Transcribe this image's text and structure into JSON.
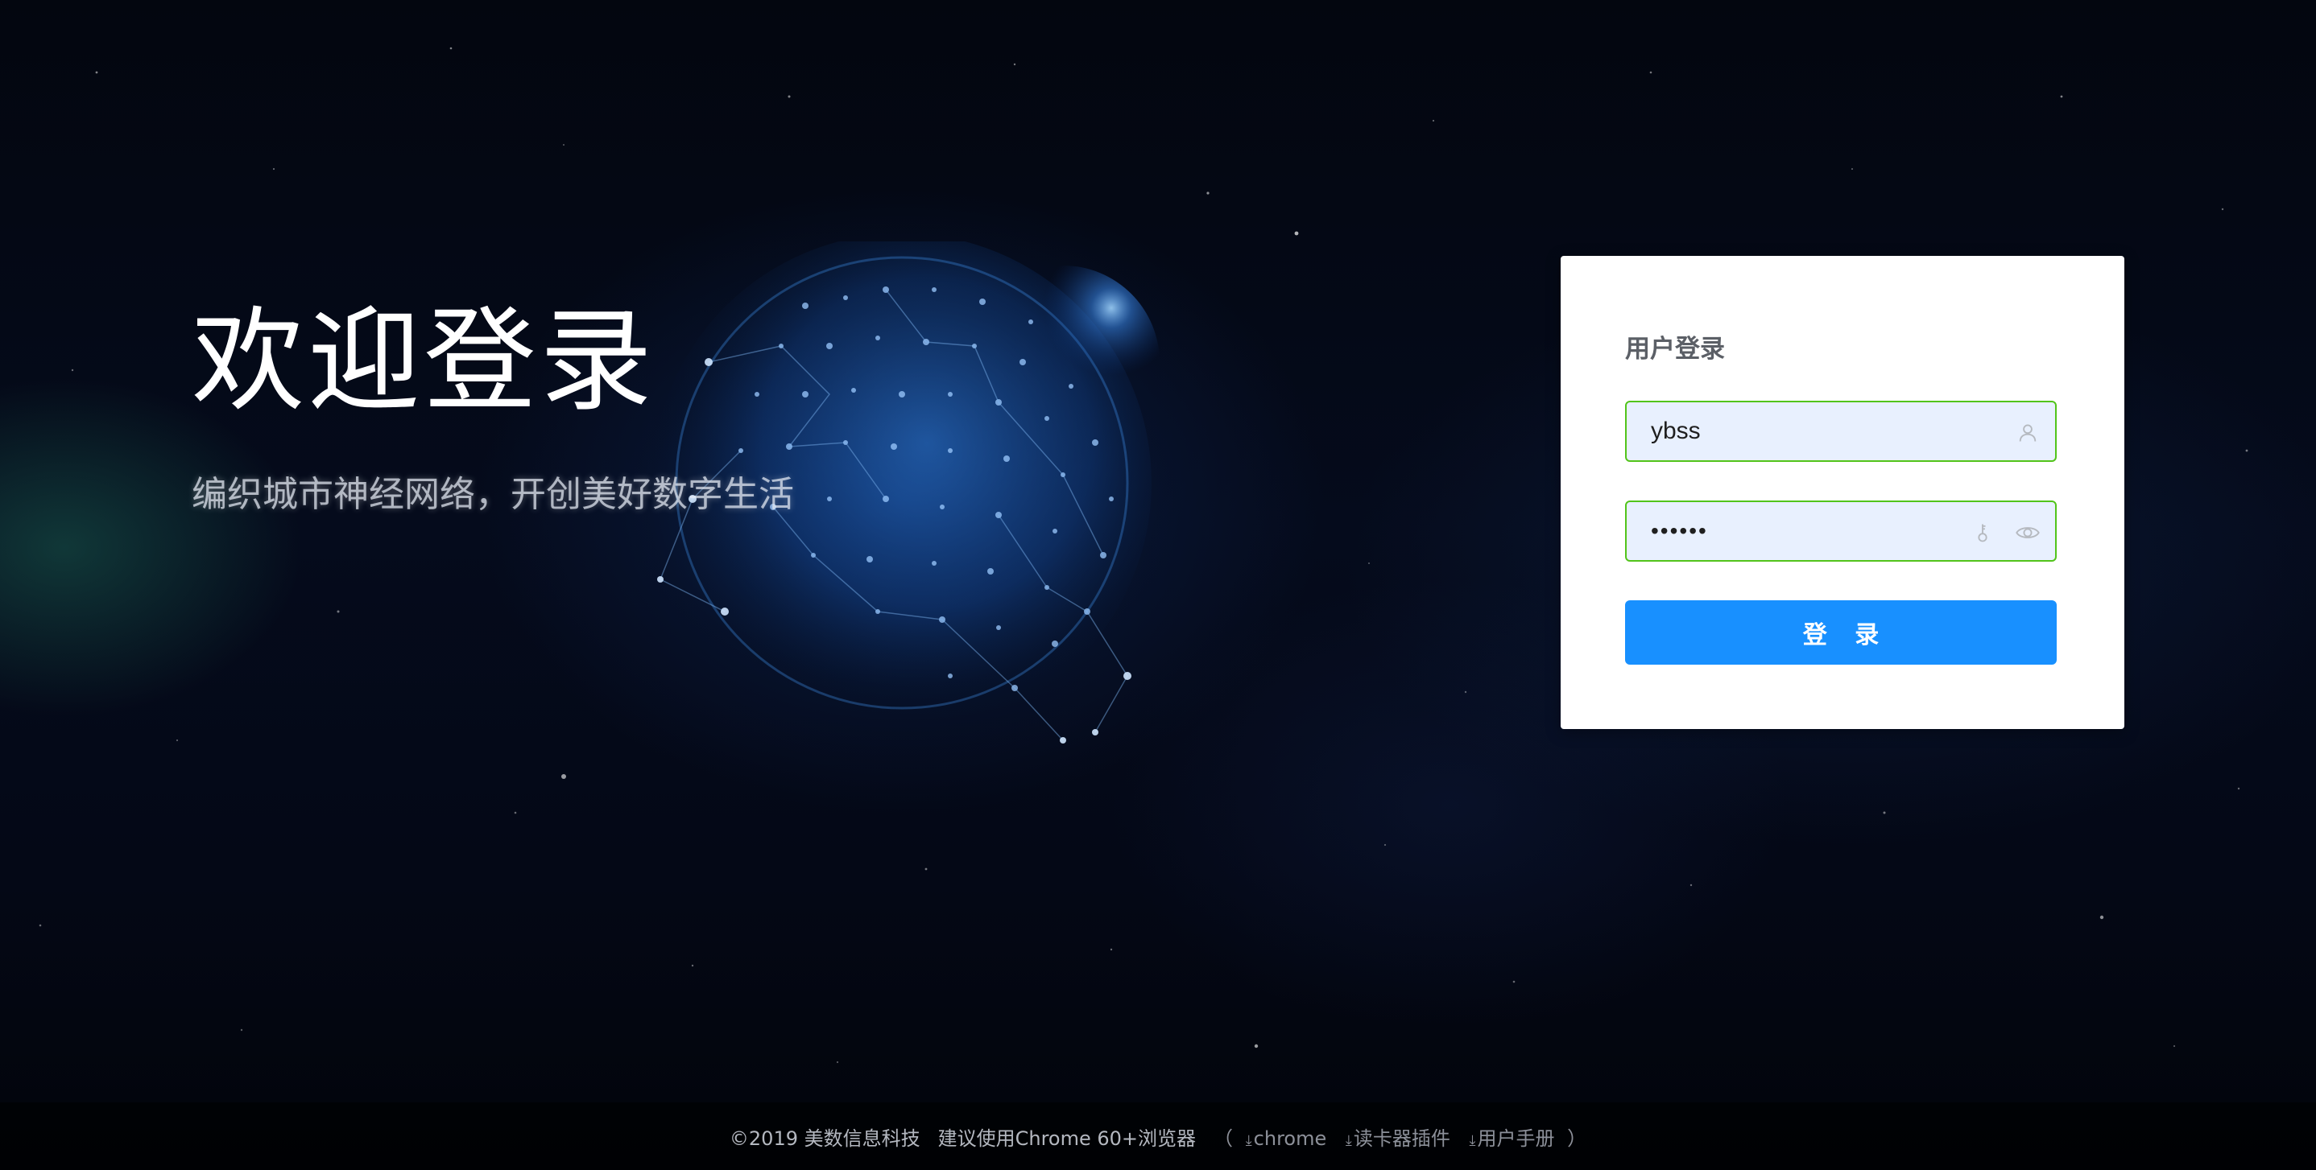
{
  "hero": {
    "title": "欢迎登录",
    "slogan": "编织城市神经网络，开创美好数字生活"
  },
  "login": {
    "title": "用户登录",
    "username": "ybss",
    "password_masked": "••••••",
    "submit_label": "登 录",
    "icons": [
      "user-icon",
      "key-icon",
      "eye-icon"
    ],
    "colors": {
      "button": "#1890ff",
      "field_border": "#52c41a",
      "field_bg": "#e8f0fe"
    }
  },
  "footer": {
    "copyright": "©2019 美数信息科技",
    "browser_hint": "建议使用Chrome 60+浏览器",
    "open_paren": "（",
    "close_paren": "）",
    "download_glyph": "⤓",
    "links": {
      "chrome": "chrome",
      "card_reader_plugin": "读卡器插件",
      "user_manual": "用户手册"
    }
  }
}
